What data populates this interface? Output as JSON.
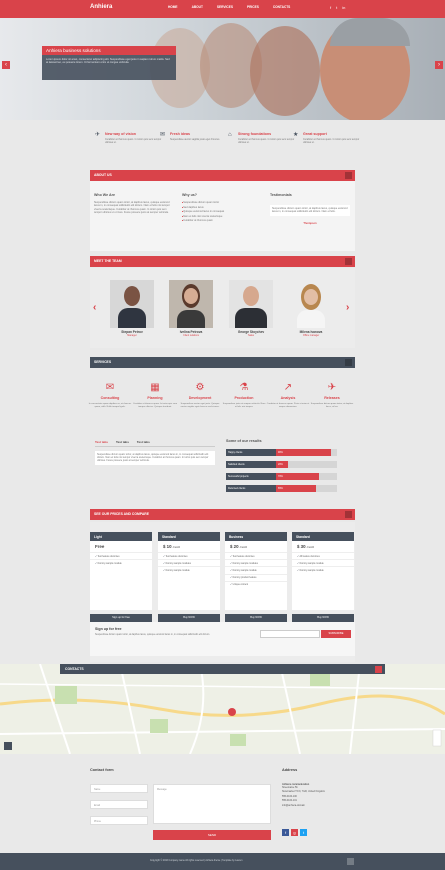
{
  "header": {
    "logo": "Anhiera",
    "nav": [
      "HOME",
      "ABOUT",
      "SERVICES",
      "PRICES",
      "CONTACTS"
    ],
    "social": [
      "f",
      "t",
      "in"
    ]
  },
  "hero": {
    "title": "Anhiera business solutions",
    "text": "Lorem ipsum dolor sit amet, consectetur adipiscing elit. Suspendisse eget justo in sapien rutrum mattis. Sed at laoreet leo, eu posuere lorem. Ut fermentum enim ut congue vehicula."
  },
  "features": [
    {
      "icon": "✈",
      "title": "New way of vision",
      "text": "Curabitur at rhoncus quam. In tortor quis sem tempor ultricies ut."
    },
    {
      "icon": "✉",
      "title": "Fresh ideas",
      "text": "Suspendisse auctor sagittis justo eget rhoncus."
    },
    {
      "icon": "⌂",
      "title": "Strong foundations",
      "text": "Curabitur at rhoncus quam. In tortor quis sem tempor ultricies ut."
    },
    {
      "icon": "★",
      "title": "Great support",
      "text": "Curabitur at rhoncus quam. In tortor quis sem tempor ultricies ut."
    }
  ],
  "about": {
    "bar": "ABOUT US",
    "who_title": "Who We Are",
    "who_text": "Suspendisse dictum quam tortor, at dapibus lacus, quisque euismod lacus in, in consequat sollicitudin elit dictum. Nam et felis nisi tempor viverra scelerisque. Curabitur at rhoncus quam. In tortor quis sem tempor ultricies ut ut risus. Fusce posuere justo at semper vehicula.",
    "why_title": "Why us?",
    "why_items": [
      "Suspendisse dictum quam tortor",
      "Sed dapibus lacus",
      "Quisque euismod lacus in consequat",
      "Nam et felis nisi viverra scelerisque",
      "Curabitur at rhoncus quam"
    ],
    "test_title": "Testimonials",
    "test_text": "Suspendisse dictum quam tortor, at dapibus lacus, quisque euismod lacus in, in consequat sollicitudin elit dictum. Nam et felis.",
    "test_author": "Thompson"
  },
  "team": {
    "bar": "MEET THE TEAM",
    "members": [
      {
        "name": "Stepan Petrov",
        "role": "Manager"
      },
      {
        "name": "Ivelina Petrova",
        "role": "Client relations"
      },
      {
        "name": "George Stoychev",
        "role": "Sales"
      },
      {
        "name": "Milena Ivanova",
        "role": "Office manager"
      }
    ]
  },
  "services": {
    "bar": "SERVICES",
    "items": [
      {
        "icon": "✉",
        "title": "Consulting",
        "text": "In consectetur quam dapibus ex, at rhoncus quam, nibh. Nulla tempor ligula."
      },
      {
        "icon": "▦",
        "title": "Planning",
        "text": "Curabitur at rhoncus quam. In tortor quis sem tempor ultricies. Quisque tincidunt."
      },
      {
        "icon": "⚙",
        "title": "Development",
        "text": "Suspendisse auctor eget justo. Quisque auctor sagittis eget rhoncus sed viverra."
      },
      {
        "icon": "⚗",
        "title": "Production",
        "text": "Suspendisse justo at semper vehicula. Nam et felis nisi tempor."
      },
      {
        "icon": "↗",
        "title": "Analysis",
        "text": "Curabitur at rhoncus quam. Proin at enim et neque elementum."
      },
      {
        "icon": "✈",
        "title": "Releases",
        "text": "Suspendisse dictum quam tortor, at dapibus lacus, at leo."
      }
    ],
    "tabs": [
      "Test tabs",
      "Test tabs",
      "Test tabs"
    ],
    "tab_text": "Suspendisse dictum quam tortor, at dapibus lacus, quisque euismod lacus in, in consequat sollicitudin elit dictum. Nam et felis nisi tempor viverra scelerisque. Curabitur at rhoncus quam. In tortor quis sem tempor ultricies. Fusce posuere justo at semper vehicula.",
    "skills_title": "Some of our results",
    "skills": [
      {
        "label": "Happy clients",
        "value": 90,
        "text": "90%"
      },
      {
        "label": "Satisfied clients",
        "value": 20,
        "text": "20%"
      },
      {
        "label": "Successful projects",
        "value": 70,
        "text": "70%"
      },
      {
        "label": "Returned clients",
        "value": 65,
        "text": "65%"
      }
    ]
  },
  "pricing": {
    "bar": "SEE OUR PRICES AND COMPARE",
    "plans": [
      {
        "name": "Light",
        "price": "Free",
        "period": "",
        "features": [
          "Test feature dummies",
          "Dummy sample module"
        ],
        "button": "Sign up for free"
      },
      {
        "name": "Standard",
        "price": "$ 10",
        "period": "/month",
        "features": [
          "Test feature dummies",
          "Dummy sample modules",
          "Dummy sample module"
        ],
        "button": "Buy NOW"
      },
      {
        "name": "Business",
        "price": "$ 20",
        "period": "/month",
        "features": [
          "Test feature dummies",
          "Dummy sample modules",
          "Dummy sample module",
          "Dummy product feature",
          "Unique content"
        ],
        "button": "Buy NOW"
      },
      {
        "name": "Standard",
        "price": "$ 30",
        "period": "/month",
        "features": [
          "All feature dummies",
          "Dummy sample module",
          "Dummy sample module"
        ],
        "button": "Buy NOW"
      }
    ],
    "signup_title": "Sign up for free",
    "signup_text": "Suspendisse dictum quam tortor, at dapibus lacus, quisque euismod lacus in, in consequat sollicitudin elit dictum.",
    "subscribe": "SUBSCRIBE"
  },
  "contacts": {
    "bar": "CONTACTS",
    "form_title": "Contact form",
    "name_ph": "Name",
    "email_ph": "Email",
    "phone_ph": "Phone",
    "message_ph": "Message",
    "send": "SEND",
    "address_title": "Address",
    "address_lines": [
      "Anhiera communication",
      "Streetname 5b",
      "Stowmarket TN 9, 7GR, United Kingdom",
      "",
      "555-0100-100",
      "555-0100-101",
      "",
      "info@anhiera-domain"
    ]
  },
  "footer": {
    "text": "Copyright © 2016 Company name All rights reserved | Anhiera theme | Template by Lauren"
  },
  "colors": {
    "accent": "#d9434a",
    "dark": "#46505d"
  }
}
